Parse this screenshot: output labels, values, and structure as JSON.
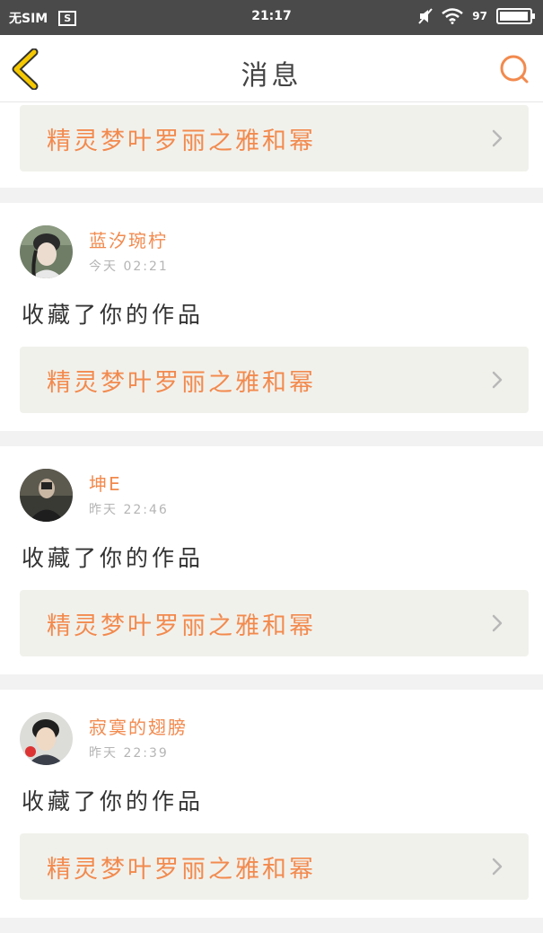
{
  "status_bar": {
    "carrier": "无SIM",
    "sim_badge": "S",
    "time": "21:17",
    "battery": "97",
    "battery_level": 0.97
  },
  "header": {
    "title": "消息",
    "back_icon": "chevron-left-icon",
    "search_icon": "search-icon"
  },
  "colors": {
    "accent": "#f28a4e",
    "back_arrow": "#f5c800"
  },
  "work_title": "精灵梦叶罗丽之雅和幂",
  "messages": [
    {
      "name": "蓝汐琬柠",
      "time": "今天 02:21",
      "action": "收藏了你的作品",
      "work": "精灵梦叶罗丽之雅和幂"
    },
    {
      "name": "坤E",
      "time": "昨天 22:46",
      "action": "收藏了你的作品",
      "work": "精灵梦叶罗丽之雅和幂"
    },
    {
      "name": "寂寞的翅膀",
      "time": "昨天 22:39",
      "action": "收藏了你的作品",
      "work": "精灵梦叶罗丽之雅和幂"
    }
  ]
}
